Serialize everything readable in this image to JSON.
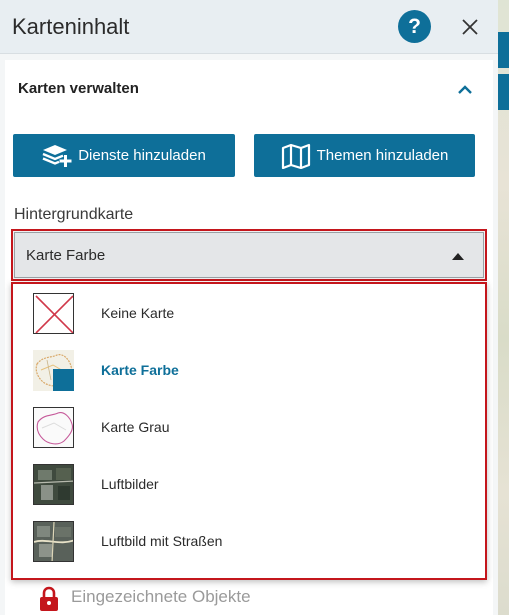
{
  "header": {
    "title": "Karteninhalt",
    "help_icon": "question-icon",
    "close_icon": "close-icon",
    "help_label": "?"
  },
  "section": {
    "title": "Karten verwalten",
    "toggle_icon": "chevron-up-icon"
  },
  "buttons": {
    "dienste_label": "Dienste hinzuladen",
    "dienste_icon": "layers-plus-icon",
    "themen_label": "Themen hinzuladen",
    "themen_icon": "map-icon"
  },
  "basemap": {
    "label": "Hintergrundkarte",
    "selected": "Karte Farbe",
    "options": [
      {
        "label": "Keine Karte",
        "icon": "no-map-icon"
      },
      {
        "label": "Karte Farbe",
        "icon": "color-map-thumbnail",
        "selected": true
      },
      {
        "label": "Karte Grau",
        "icon": "gray-map-thumbnail"
      },
      {
        "label": "Luftbilder",
        "icon": "aerial-thumbnail"
      },
      {
        "label": "Luftbild mit Straßen",
        "icon": "aerial-streets-thumbnail"
      }
    ]
  },
  "locked_layer": {
    "label": "Eingezeichnete Objekte",
    "icon": "lock-icon"
  },
  "colors": {
    "accent": "#0e6f99",
    "highlight_border": "#c4161c",
    "lock": "#c4161c"
  }
}
